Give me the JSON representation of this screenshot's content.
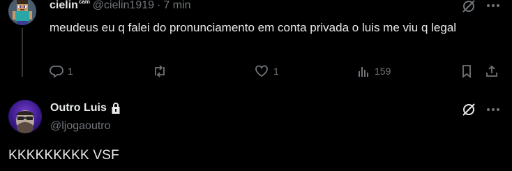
{
  "reply": {
    "display_name": "cielin",
    "name_suffix": "ᶜᵃᵐ",
    "handle": "@cielin1919",
    "separator": "·",
    "timestamp": "7 min",
    "text": "meudeus eu q falei do pronunciamento em conta privada o luis me viu q legal",
    "stats": {
      "replies": "1",
      "reposts": "",
      "likes": "1",
      "views": "159"
    },
    "icons": [
      "grok-icon",
      "more-icon",
      "reply-icon",
      "repost-icon",
      "like-icon",
      "views-icon",
      "bookmark-icon",
      "share-icon"
    ]
  },
  "post": {
    "display_name": "Outro Luis",
    "handle": "@ljogaoutro",
    "protected": true,
    "text": "KKKKKKKKK VSF",
    "icons": [
      "lock-icon",
      "grok-icon",
      "more-icon"
    ]
  },
  "colors": {
    "background": "#000000",
    "text": "#e7e9ea",
    "muted": "#71767b",
    "divider": "#2f3336"
  }
}
